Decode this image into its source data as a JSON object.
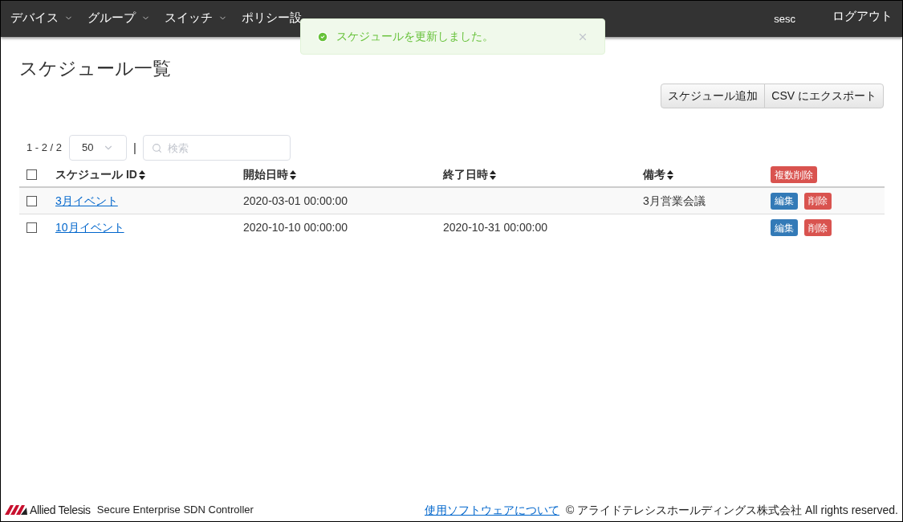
{
  "nav": {
    "items": [
      {
        "label": "デバイス",
        "dropdown": true
      },
      {
        "label": "グループ",
        "dropdown": true
      },
      {
        "label": "スイッチ",
        "dropdown": true
      },
      {
        "label": "ポリシー設",
        "dropdown": false
      }
    ],
    "user": "sesc",
    "logout": "ログアウト"
  },
  "toast": {
    "message": "スケジュールを更新しました。"
  },
  "title": "スケジュール一覧",
  "actions": [
    "スケジュール追加",
    "CSV にエクスポート"
  ],
  "toolbar": {
    "count": "1 - 2 / 2",
    "page_size": "50",
    "separator": "|",
    "search": {
      "placeholder": "検索"
    }
  },
  "table": {
    "select_all": {
      "checked": false
    },
    "columns": [
      "スケジュール ID",
      "開始日時",
      "終了日時",
      "備考"
    ],
    "bulk_delete": "複数削除",
    "rows": [
      {
        "checked": false,
        "id": "3月イベント",
        "start": "2020-03-01 00:00:00",
        "end": "",
        "note": "3月営業会議",
        "edit": "編集",
        "delete": "削除"
      },
      {
        "checked": false,
        "id": "10月イベント",
        "start": "2020-10-10 00:00:00",
        "end": "2020-10-31 00:00:00",
        "note": "",
        "edit": "編集",
        "delete": "削除"
      }
    ]
  },
  "footer": {
    "brand": "Allied Telesis",
    "product": "Secure Enterprise SDN Controller",
    "link": "使用ソフトウェアについて",
    "copyright": "© アライドテレシスホールディングス株式会社 All rights reserved."
  }
}
